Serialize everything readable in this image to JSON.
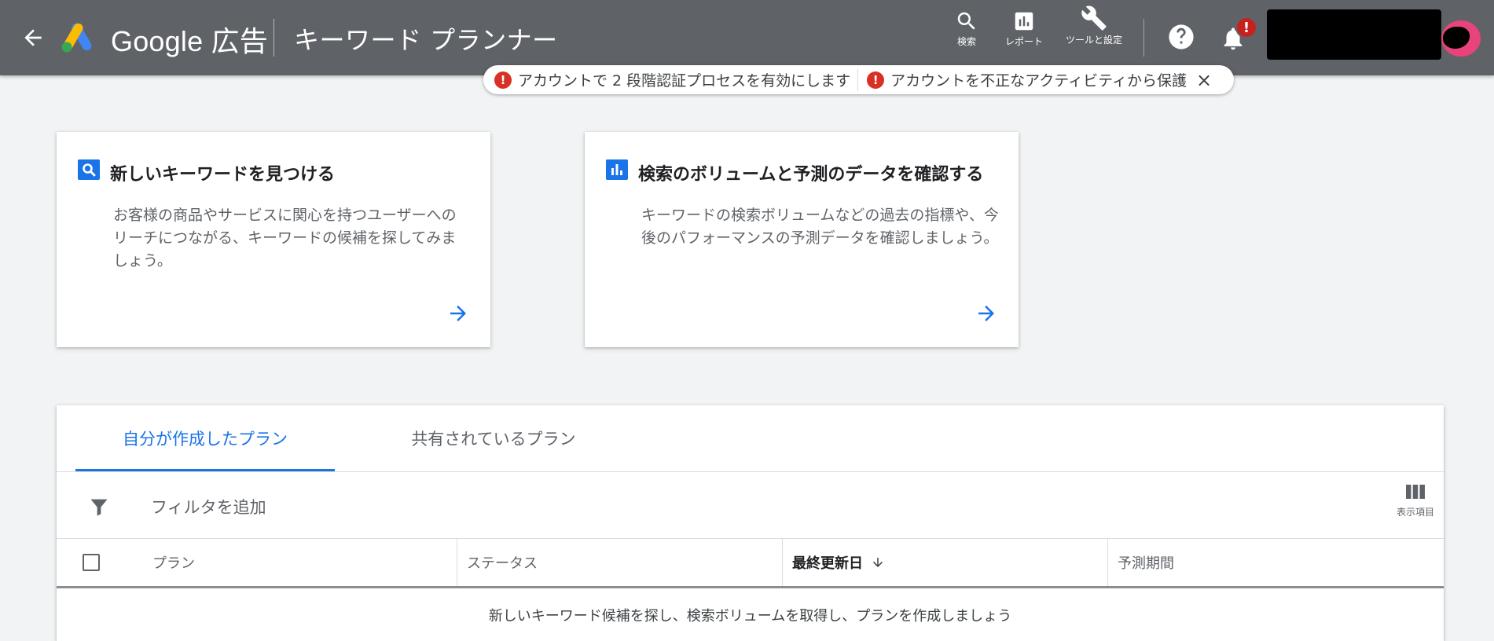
{
  "header": {
    "brand": "Google 広告",
    "page_title": "キーワード プランナー",
    "tools": {
      "search_label": "検索",
      "reports_label": "レポート",
      "tools_label": "ツールと設定"
    },
    "notification_badge": "!",
    "colors": {
      "bar": "#5f6368",
      "badge": "#c5221f",
      "avatar": "#e8437a"
    }
  },
  "notification": {
    "items": [
      "アカウントで 2 段階認証プロセスを有効にします",
      "アカウントを不正なアクティビティから保護"
    ],
    "alert_glyph": "!",
    "close_glyph": "×"
  },
  "cards": [
    {
      "icon": "search-icon",
      "title": "新しいキーワードを見つける",
      "description": "お客様の商品やサービスに関心を持つユーザーへのリーチにつながる、キーワードの候補を探してみましょう。"
    },
    {
      "icon": "bar-chart-icon",
      "title": "検索のボリュームと予測のデータを確認する",
      "description": "キーワードの検索ボリュームなどの過去の指標や、今後のパフォーマンスの予測データを確認しましょう。"
    }
  ],
  "plans": {
    "tabs": [
      "自分が作成したプラン",
      "共有されているプラン"
    ],
    "active_tab": "自分が作成したプラン",
    "filter_label": "フィルタを追加",
    "columns_label": "表示項目",
    "table": {
      "headers": [
        "プラン",
        "ステータス",
        "最終更新日",
        "予測期間"
      ],
      "sorted_column": "最終更新日",
      "sort_direction": "descending"
    },
    "empty_message": "新しいキーワード候補を探し、検索ボリュームを取得し、プランを作成しましょう"
  },
  "accent_color": "#1a73e8"
}
